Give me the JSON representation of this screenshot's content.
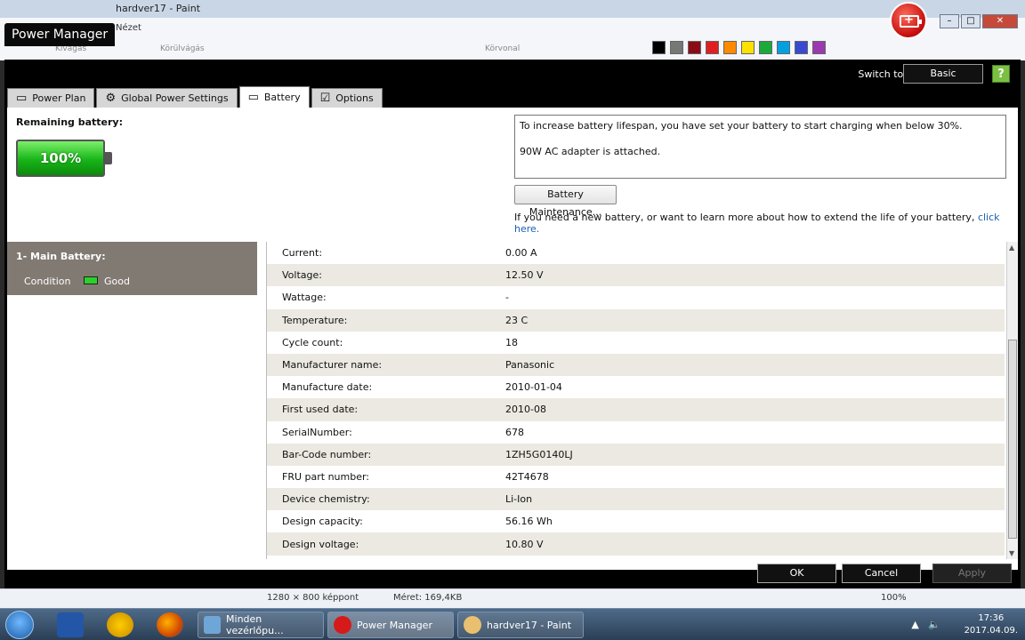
{
  "paint": {
    "title": "hardver17 - Paint",
    "tab_view": "Nézet",
    "crop": "Kivágás",
    "resize": "Körülvágás",
    "outline": "Körvonal",
    "statusbar": {
      "dimensions": "1280 × 800 képpont",
      "size": "Méret: 169,4KB",
      "zoom": "100%"
    }
  },
  "window": {
    "title": "Power Manager",
    "switch_label": "Switch to:",
    "switch_button": "Basic",
    "help_icon": "?"
  },
  "tabs": [
    {
      "label": "Power Plan",
      "icon": "battery-outline-icon"
    },
    {
      "label": "Global Power Settings",
      "icon": "gear-icon"
    },
    {
      "label": "Battery",
      "icon": "battery-icon"
    },
    {
      "label": "Options",
      "icon": "checkbox-icon"
    }
  ],
  "battery": {
    "remaining_label": "Remaining battery:",
    "percent": "100%",
    "info_line1": "To increase battery lifespan, you have set your battery to start charging when below 30%.",
    "info_line2": "90W AC adapter is attached.",
    "maintenance_button": "Battery Maintenance...",
    "help_text": "If you need a new battery, or want to learn more about how to extend the life of your battery,",
    "help_link": "click here."
  },
  "main_battery": {
    "name": "1- Main Battery:",
    "condition_label": "Condition",
    "condition_value": "Good"
  },
  "details": [
    {
      "key": "Current:",
      "value": "0.00 A"
    },
    {
      "key": "Voltage:",
      "value": "12.50 V"
    },
    {
      "key": "Wattage:",
      "value": "-"
    },
    {
      "key": "Temperature:",
      "value": "23 C"
    },
    {
      "key": "Cycle count:",
      "value": "18"
    },
    {
      "key": "Manufacturer name:",
      "value": "Panasonic"
    },
    {
      "key": "Manufacture date:",
      "value": "2010-01-04"
    },
    {
      "key": "First used date:",
      "value": "2010-08"
    },
    {
      "key": "SerialNumber:",
      "value": "678"
    },
    {
      "key": "Bar-Code number:",
      "value": "1ZH5G0140LJ"
    },
    {
      "key": "FRU part number:",
      "value": "42T4678"
    },
    {
      "key": "Device chemistry:",
      "value": "Li-Ion"
    },
    {
      "key": "Design capacity:",
      "value": "56.16 Wh"
    },
    {
      "key": "Design voltage:",
      "value": "10.80 V"
    }
  ],
  "buttons": {
    "ok": "OK",
    "cancel": "Cancel",
    "apply": "Apply"
  },
  "taskbar": {
    "tasks": [
      "Minden vezérlőpu...",
      "Power Manager",
      "hardver17 - Paint"
    ],
    "time": "17:36",
    "date": "2017.04.09."
  },
  "colors": {
    "accent_green": "#18b418",
    "panel_gray": "#817a72",
    "link_blue": "#1a5fb4"
  }
}
